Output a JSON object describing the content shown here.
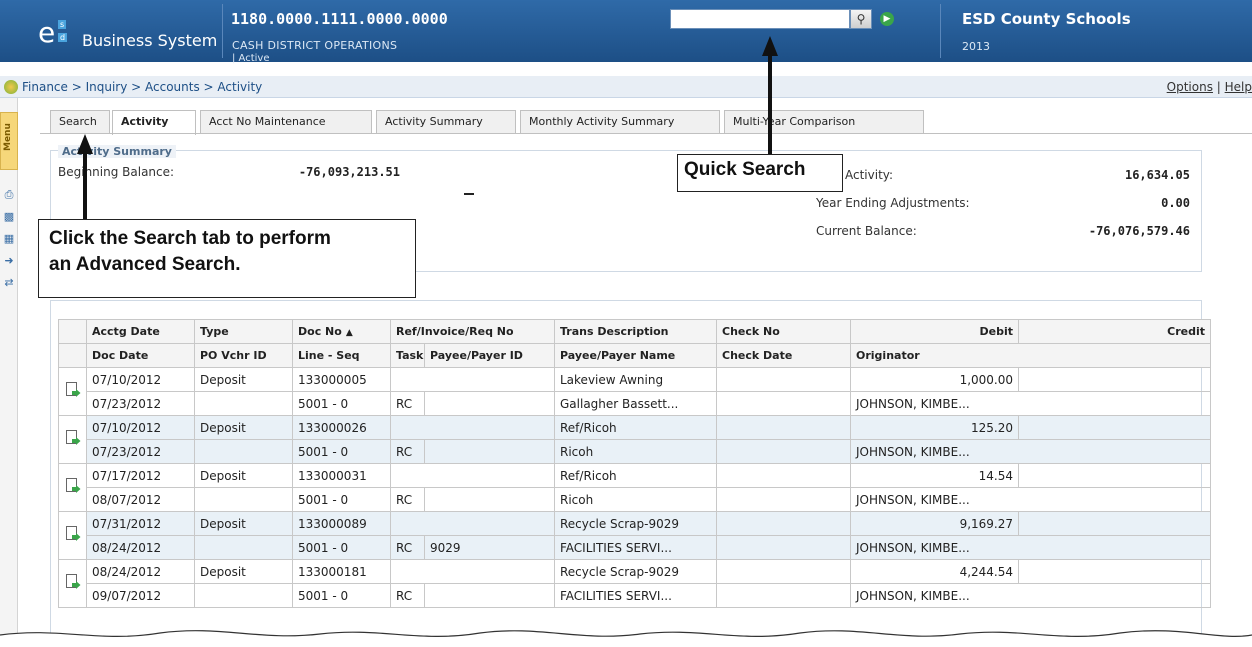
{
  "header": {
    "logo": {
      "letter": "e",
      "sup": "s",
      "sub": "d"
    },
    "app_name": "Business System",
    "account_number": "1180.0000.1111.0000.0000",
    "account_description": "CASH DISTRICT OPERATIONS",
    "account_status": "| Active",
    "search_placeholder": "",
    "district": "ESD County Schools",
    "year": "2013"
  },
  "breadcrumb": {
    "path": "Finance > Inquiry > Accounts > Activity",
    "options": "Options",
    "separator": " | ",
    "help": "Help"
  },
  "sidebar": {
    "menu_label": "Menu",
    "icons": [
      "print-icon",
      "chart-icon",
      "calculator-icon",
      "export-icon",
      "transfer-icon"
    ]
  },
  "tabs": [
    "Search",
    "Activity",
    "Acct No Maintenance",
    "Activity Summary",
    "Monthly Activity Summary",
    "Multi-Year Comparison"
  ],
  "active_tab": "Activity",
  "summary": {
    "legend": "Activity Summary",
    "beginning_balance_label": "Beginning Balance:",
    "beginning_balance": "-76,093,213.51",
    "activity_label": "Activity:",
    "activity": "16,634.05",
    "year_end_label": "Year Ending Adjustments:",
    "year_end": "0.00",
    "current_balance_label": "Current Balance:",
    "current_balance": "-76,076,579.46"
  },
  "grid": {
    "header1": [
      "Acctg Date",
      "Type",
      "Doc No",
      "Ref/Invoice/Req No",
      "Trans Description",
      "Check No",
      "Debit",
      "Credit"
    ],
    "header2": [
      "Doc Date",
      "PO Vchr ID",
      "Line - Seq",
      "Task",
      "Payee/Payer ID",
      "Payee/Payer Name",
      "Check Date",
      "Originator"
    ],
    "sort_indicator": "▲",
    "rows": [
      {
        "acctg_date": "07/10/2012",
        "type": "Deposit",
        "doc_no": "133000005",
        "ref": "",
        "trans_desc": "Lakeview Awning",
        "check_no": "",
        "debit": "1,000.00",
        "credit": "",
        "doc_date": "07/23/2012",
        "po_vchr": "",
        "line_seq": "5001 - 0",
        "task": "RC",
        "payee_id": "",
        "payee_name": "Gallagher Bassett...",
        "check_date": "",
        "originator": "JOHNSON, KIMBE..."
      },
      {
        "acctg_date": "07/10/2012",
        "type": "Deposit",
        "doc_no": "133000026",
        "ref": "",
        "trans_desc": "Ref/Ricoh",
        "check_no": "",
        "debit": "125.20",
        "credit": "",
        "doc_date": "07/23/2012",
        "po_vchr": "",
        "line_seq": "5001 - 0",
        "task": "RC",
        "payee_id": "",
        "payee_name": "Ricoh",
        "check_date": "",
        "originator": "JOHNSON, KIMBE..."
      },
      {
        "acctg_date": "07/17/2012",
        "type": "Deposit",
        "doc_no": "133000031",
        "ref": "",
        "trans_desc": "Ref/Ricoh",
        "check_no": "",
        "debit": "14.54",
        "credit": "",
        "doc_date": "08/07/2012",
        "po_vchr": "",
        "line_seq": "5001 - 0",
        "task": "RC",
        "payee_id": "",
        "payee_name": "Ricoh",
        "check_date": "",
        "originator": "JOHNSON, KIMBE..."
      },
      {
        "acctg_date": "07/31/2012",
        "type": "Deposit",
        "doc_no": "133000089",
        "ref": "",
        "trans_desc": "Recycle Scrap-9029",
        "check_no": "",
        "debit": "9,169.27",
        "credit": "",
        "doc_date": "08/24/2012",
        "po_vchr": "",
        "line_seq": "5001 - 0",
        "task": "RC",
        "payee_id": "9029",
        "payee_name": "FACILITIES SERVI...",
        "check_date": "",
        "originator": "JOHNSON, KIMBE..."
      },
      {
        "acctg_date": "08/24/2012",
        "type": "Deposit",
        "doc_no": "133000181",
        "ref": "",
        "trans_desc": "Recycle Scrap-9029",
        "check_no": "",
        "debit": "4,244.54",
        "credit": "",
        "doc_date": "09/07/2012",
        "po_vchr": "",
        "line_seq": "5001 - 0",
        "task": "RC",
        "payee_id": "",
        "payee_name": "FACILITIES SERVI...",
        "check_date": "",
        "originator": "JOHNSON, KIMBE..."
      }
    ]
  },
  "annotations": {
    "quick_search": "Quick Search",
    "advanced_search_line1": "Click the Search tab to perform",
    "advanced_search_line2": "an Advanced Search."
  },
  "colors": {
    "header_bg": "#1d4f86",
    "alt_row_bg": "#e9f1f7",
    "go_button": "#3aa54a",
    "menu_tab": "#f6d77a"
  }
}
